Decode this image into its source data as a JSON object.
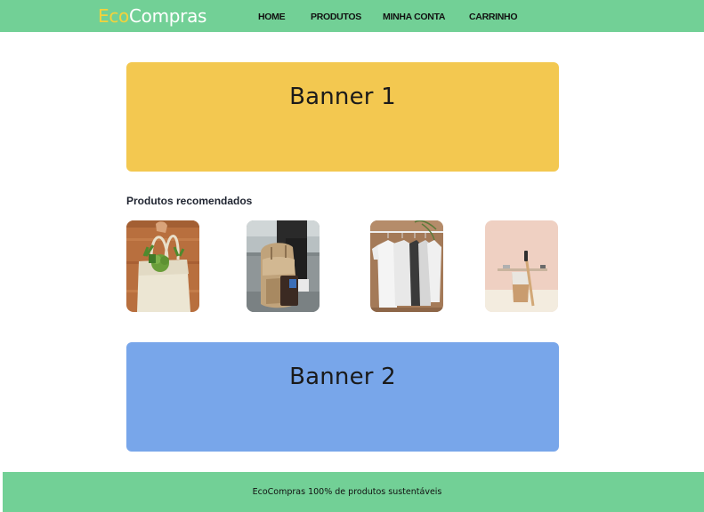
{
  "header": {
    "logo": {
      "part1": "Eco",
      "part2": "Compras"
    },
    "nav": [
      "HOME",
      "PRODUTOS",
      "MINHA CONTA",
      "CARRINHO"
    ]
  },
  "banners": [
    "Banner 1",
    "Banner 2"
  ],
  "recommended": {
    "title": "Produtos recomendados",
    "products": [
      {
        "image": "tote-bag-with-vegetables"
      },
      {
        "image": "leather-backpack"
      },
      {
        "image": "white-t-shirts-on-hangers"
      },
      {
        "image": "bamboo-toothbrush-and-cup"
      }
    ]
  },
  "footer": {
    "text": "EcoCompras 100% de produtos sustentáveis"
  },
  "colors": {
    "header_bg": "#72d096",
    "logo_accent": "#f3d23c",
    "banner_1": "#f3c850",
    "banner_2": "#78a6ea",
    "footer_bg": "#72d096"
  }
}
